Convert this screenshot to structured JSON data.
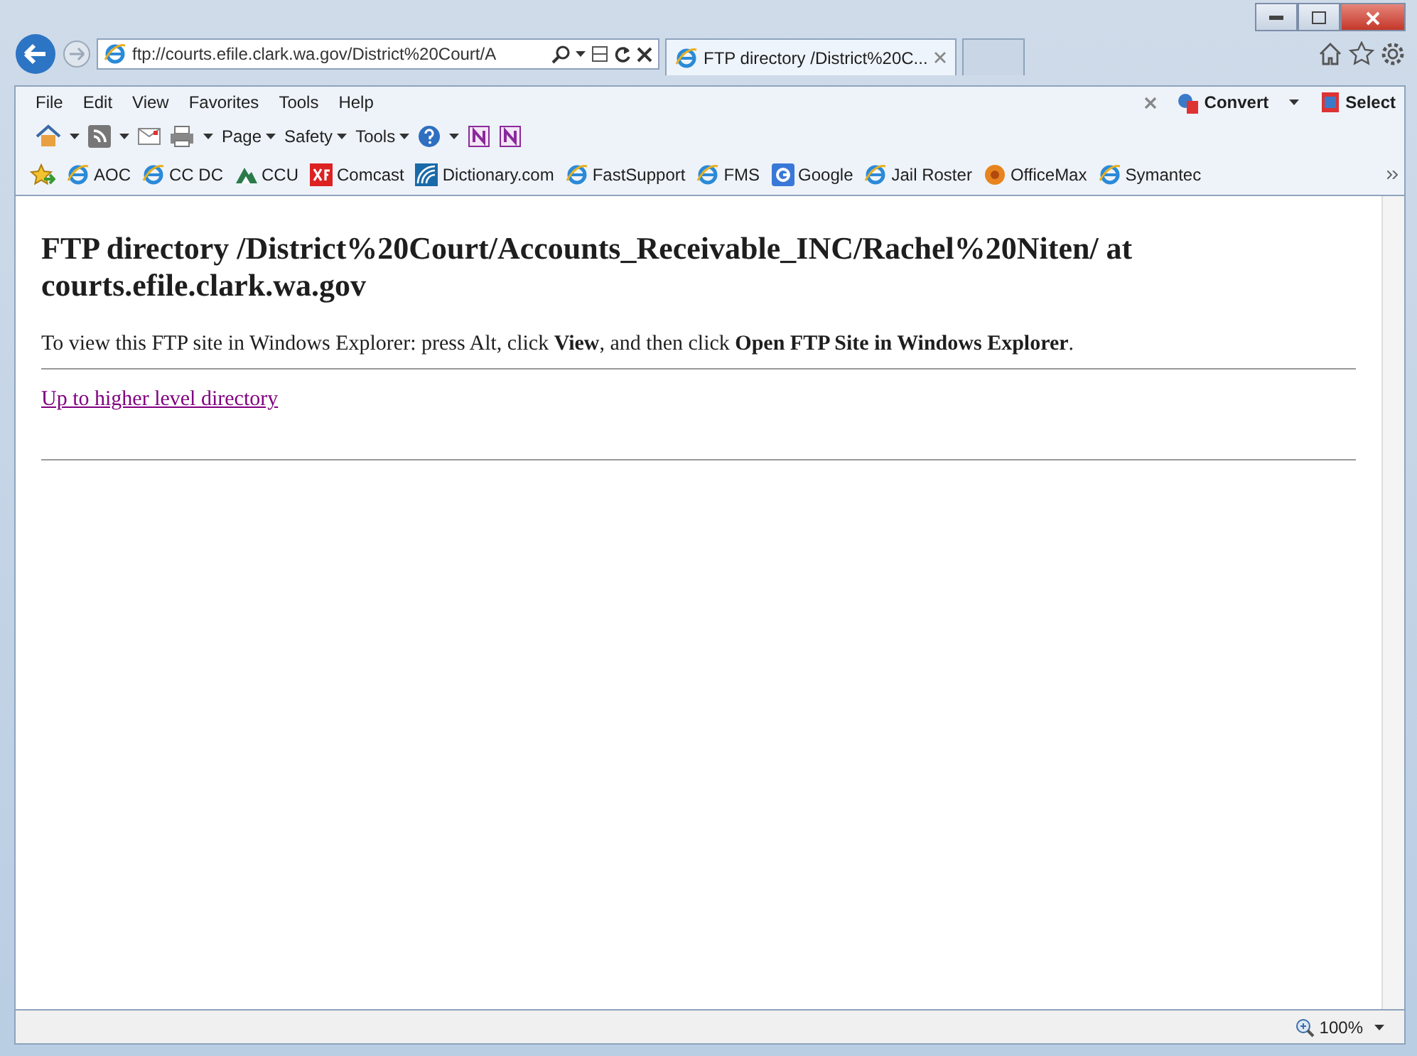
{
  "address_bar": {
    "url": "ftp://courts.efile.clark.wa.gov/District%20Court/A"
  },
  "tab": {
    "title": "FTP directory /District%20C...",
    "selected": true
  },
  "menu": [
    "File",
    "Edit",
    "View",
    "Favorites",
    "Tools",
    "Help"
  ],
  "command_bar": [
    "Page",
    "Safety",
    "Tools"
  ],
  "addon_bar": [
    "Convert",
    "Select"
  ],
  "favorites": [
    {
      "label": "AOC",
      "kind": "ie"
    },
    {
      "label": "CC DC",
      "kind": "ie"
    },
    {
      "label": "CCU",
      "kind": "mountain"
    },
    {
      "label": "Comcast",
      "kind": "xf"
    },
    {
      "label": "Dictionary.com",
      "kind": "signal"
    },
    {
      "label": "FastSupport",
      "kind": "ie"
    },
    {
      "label": "FMS",
      "kind": "ie"
    },
    {
      "label": "Google",
      "kind": "google"
    },
    {
      "label": "Jail Roster",
      "kind": "ie"
    },
    {
      "label": "OfficeMax",
      "kind": "orange"
    },
    {
      "label": "Symantec",
      "kind": "ie"
    }
  ],
  "page": {
    "heading": "FTP directory /District%20Court/Accounts_Receivable_INC/Rachel%20Niten/ at courts.efile.clark.wa.gov",
    "instruction": "To view this FTP site in Windows Explorer: press Alt, click **View**, and then click **Open FTP Site in Windows Explorer**.",
    "link": {
      "label": "Up to higher level directory",
      "visited": true
    }
  },
  "status_bar": {
    "zoom": "100%"
  }
}
